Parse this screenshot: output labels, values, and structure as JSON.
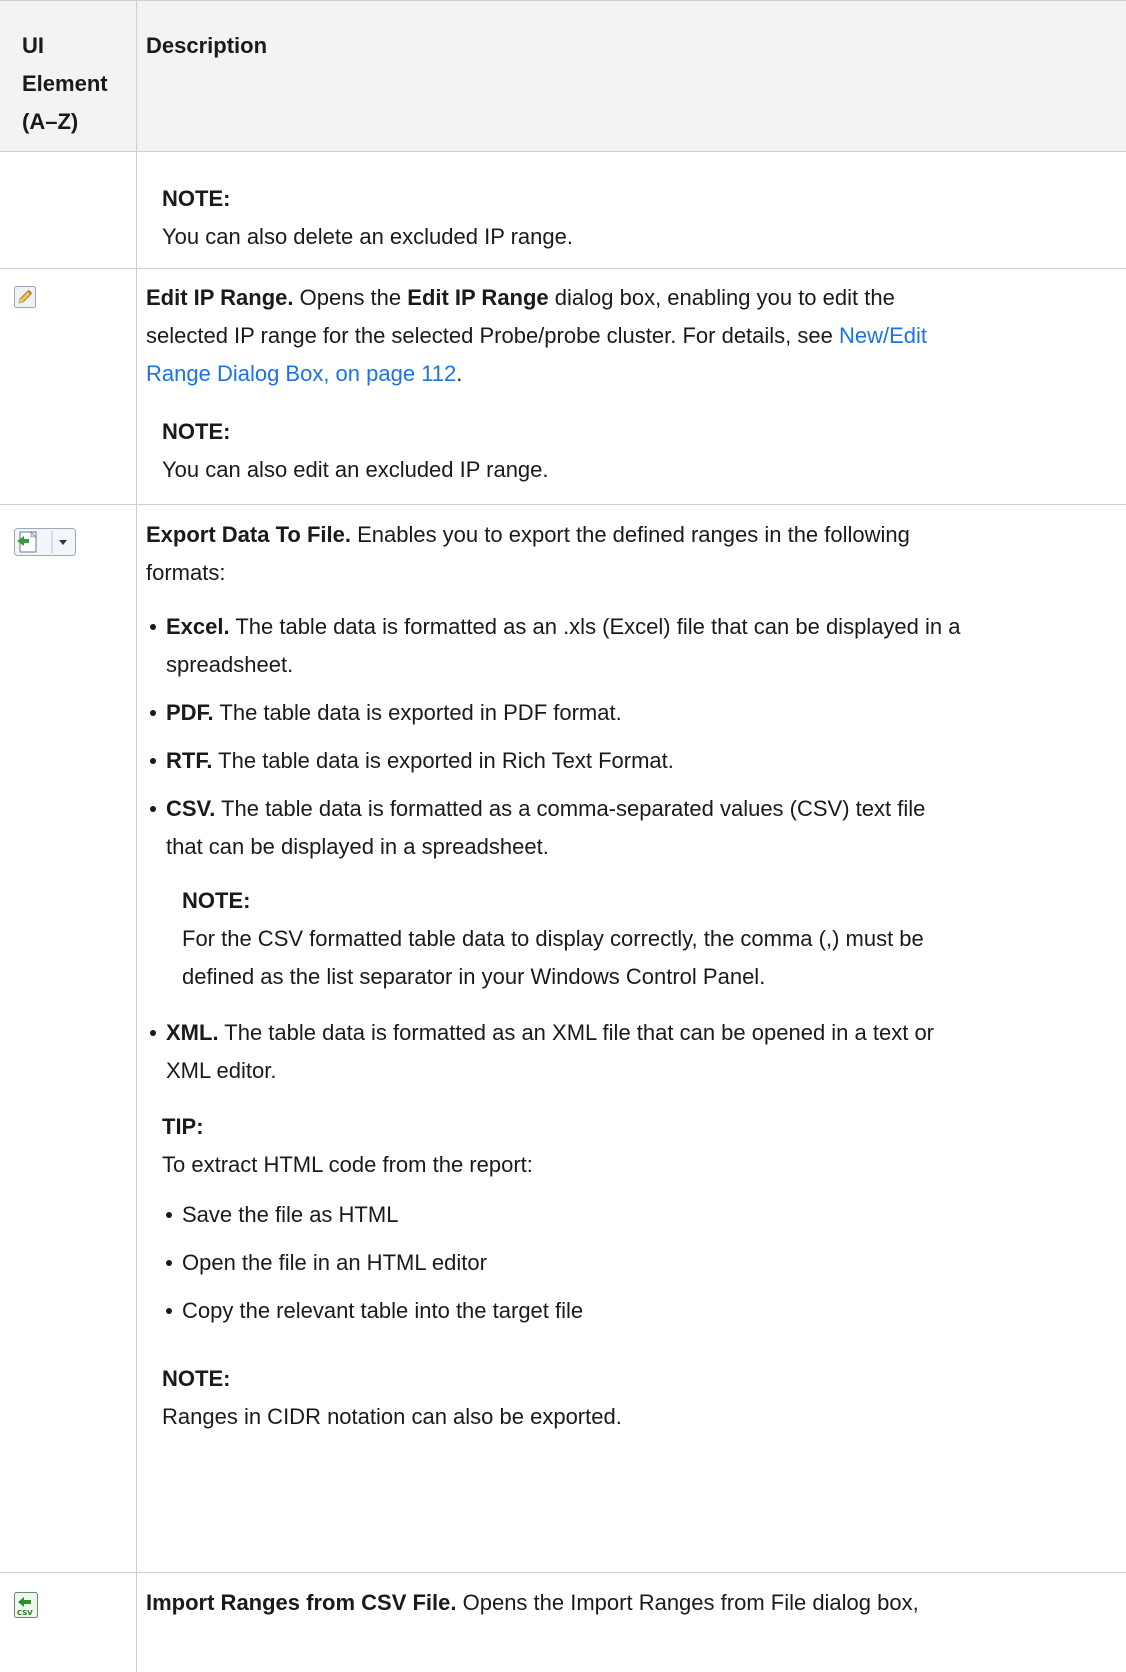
{
  "header": {
    "ui_element": [
      "UI",
      "Element",
      "(A–Z)"
    ],
    "description": "Description"
  },
  "row_delete": {
    "note_label": "NOTE:",
    "note_text": "You can also delete an excluded IP range."
  },
  "row_edit": {
    "icon": "pencil-edit-icon",
    "title": "Edit IP Range.",
    "text1": " Opens the ",
    "dialog_name": "Edit IP Range",
    "text2": " dialog box, enabling you to edit the",
    "line2": "selected IP range for the selected Probe/probe cluster. For details, see ",
    "link_part1": "New/Edit",
    "link_part2": "Range Dialog Box, on page 112",
    "period": ".",
    "note_label": "NOTE:",
    "note_text": "You can also edit an excluded IP range."
  },
  "row_export": {
    "icon": "export-file-dropdown-icon",
    "title": "Export Data To File.",
    "intro1": " Enables you to export the defined ranges in the following",
    "intro2": "formats:",
    "formats": [
      {
        "name": "Excel.",
        "text1": " The table data is formatted as an .xls (Excel) file that can be displayed in a",
        "text2": "spreadsheet."
      },
      {
        "name": "PDF.",
        "text1": " The table data is exported in PDF format.",
        "text2": ""
      },
      {
        "name": "RTF.",
        "text1": " The table data is exported in Rich Text Format.",
        "text2": ""
      },
      {
        "name": "CSV.",
        "text1": " The table data is formatted as a comma-separated values (CSV) text file",
        "text2": "that can be displayed in a spreadsheet."
      }
    ],
    "csv_note_label": "NOTE:",
    "csv_note_line1": "For the CSV formatted table data to display correctly, the comma (,) must be",
    "csv_note_line2": "defined as the list separator in your Windows Control Panel.",
    "xml": {
      "name": "XML.",
      "text1": " The table data is formatted as an XML file that can be opened in a text or",
      "text2": "XML editor."
    },
    "tip_label": "TIP:",
    "tip_intro": "To extract HTML code from the report:",
    "tip_steps": [
      "Save the file as HTML",
      "Open the file in an HTML editor",
      "Copy the relevant table into the target file"
    ],
    "note_label": "NOTE:",
    "note_text": "Ranges in CIDR notation can also be exported."
  },
  "row_import": {
    "icon": "import-csv-icon",
    "title": "Import Ranges from CSV File.",
    "text": " Opens the Import Ranges from File dialog box,"
  }
}
